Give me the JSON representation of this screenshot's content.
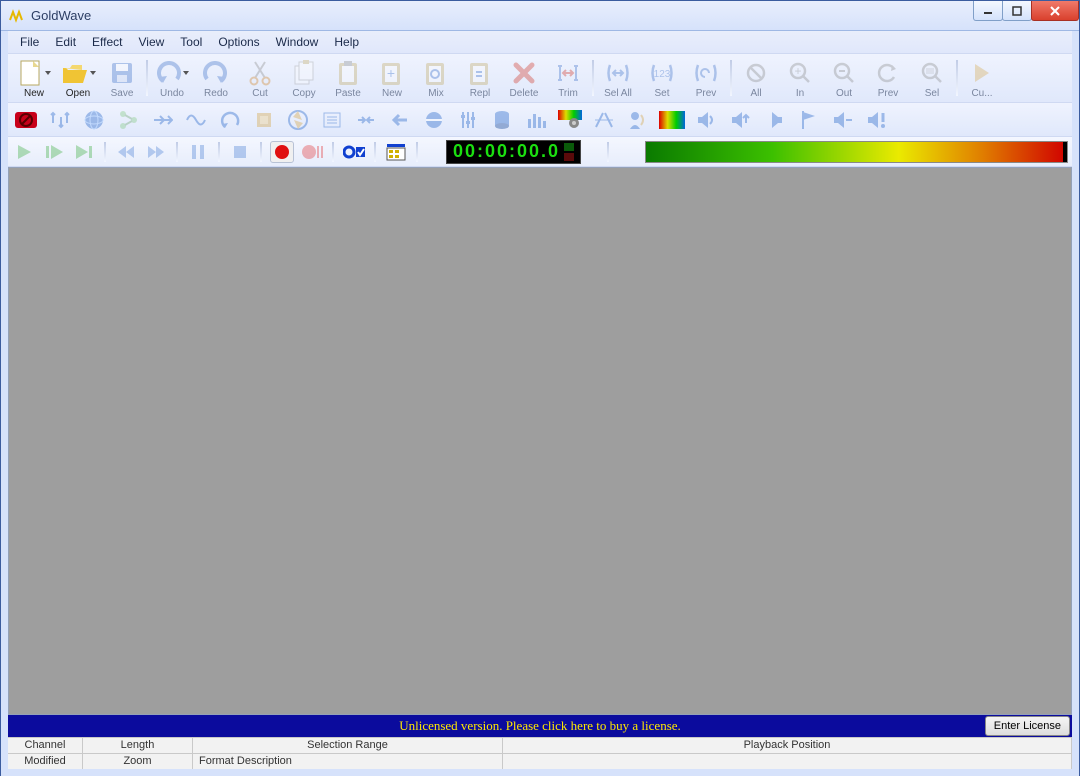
{
  "app_title": "GoldWave",
  "menu": [
    "File",
    "Edit",
    "Effect",
    "View",
    "Tool",
    "Options",
    "Window",
    "Help"
  ],
  "toolbar_main": [
    {
      "id": "new",
      "label": "New",
      "enabled": true
    },
    {
      "id": "open",
      "label": "Open",
      "enabled": true
    },
    {
      "id": "save",
      "label": "Save",
      "enabled": false
    },
    {
      "sep": true
    },
    {
      "id": "undo",
      "label": "Undo",
      "enabled": false
    },
    {
      "id": "redo",
      "label": "Redo",
      "enabled": false
    },
    {
      "id": "cut",
      "label": "Cut",
      "enabled": false
    },
    {
      "id": "copy",
      "label": "Copy",
      "enabled": false
    },
    {
      "id": "paste",
      "label": "Paste",
      "enabled": false
    },
    {
      "id": "new2",
      "label": "New",
      "enabled": false
    },
    {
      "id": "mix",
      "label": "Mix",
      "enabled": false
    },
    {
      "id": "repl",
      "label": "Repl",
      "enabled": false
    },
    {
      "id": "delete",
      "label": "Delete",
      "enabled": false
    },
    {
      "id": "trim",
      "label": "Trim",
      "enabled": false
    },
    {
      "sep": true
    },
    {
      "id": "selall",
      "label": "Sel All",
      "enabled": false
    },
    {
      "id": "set",
      "label": "Set",
      "enabled": false
    },
    {
      "id": "prev",
      "label": "Prev",
      "enabled": false
    },
    {
      "sep": true
    },
    {
      "id": "all",
      "label": "All",
      "enabled": false
    },
    {
      "id": "in",
      "label": "In",
      "enabled": false
    },
    {
      "id": "out",
      "label": "Out",
      "enabled": false
    },
    {
      "id": "prev2",
      "label": "Prev",
      "enabled": false
    },
    {
      "id": "sel",
      "label": "Sel",
      "enabled": false
    },
    {
      "sep": true
    },
    {
      "id": "cue",
      "label": "Cu...",
      "enabled": false
    }
  ],
  "timer": "00:00:00.0",
  "license_text": "Unlicensed version. Please click here to buy a license.",
  "license_button": "Enter License",
  "status_row1": [
    "Channel",
    "Length",
    "Selection Range",
    "Playback Position"
  ],
  "status_row2": [
    "Modified",
    "Zoom",
    "Format Description",
    ""
  ]
}
